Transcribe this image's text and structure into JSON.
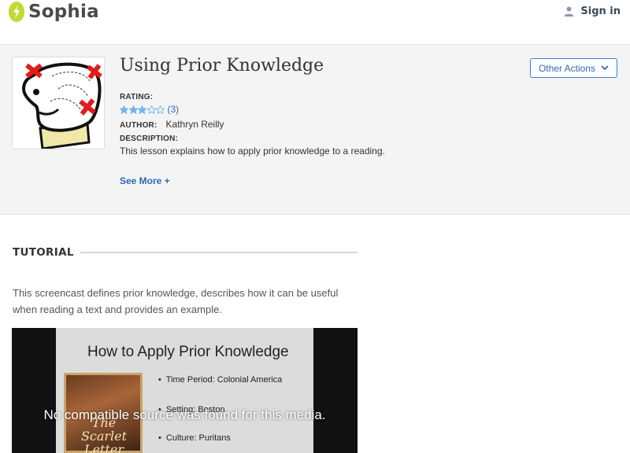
{
  "header": {
    "logo_text": "Sophia",
    "signin_label": "Sign in"
  },
  "lesson": {
    "title": "Using Prior Knowledge",
    "other_actions_label": "Other Actions",
    "rating_label": "RATING:",
    "rating_stars": 3,
    "rating_max": 5,
    "rating_count": "(3)",
    "author_label": "AUTHOR:",
    "author_name": "Kathryn Reilly",
    "description_label": "DESCRIPTION:",
    "description": "This lesson explains how to apply prior knowledge to a reading.",
    "see_more_label": "See More +"
  },
  "tutorial": {
    "heading": "TUTORIAL",
    "text": "This screencast defines prior knowledge, describes how it can be useful when reading a text and provides an example.",
    "video": {
      "slide_title": "How to Apply Prior Knowledge",
      "bullets": [
        "Time Period:  Colonial America",
        "Setting: Boston",
        "Culture: Puritans"
      ],
      "book_title": "The Scarlet Letter",
      "error_message": "No compatible source was found for this media."
    }
  },
  "colors": {
    "brand_green": "#c3d834",
    "link_blue": "#2a6ab8",
    "star_blue": "#6fb6e6"
  }
}
